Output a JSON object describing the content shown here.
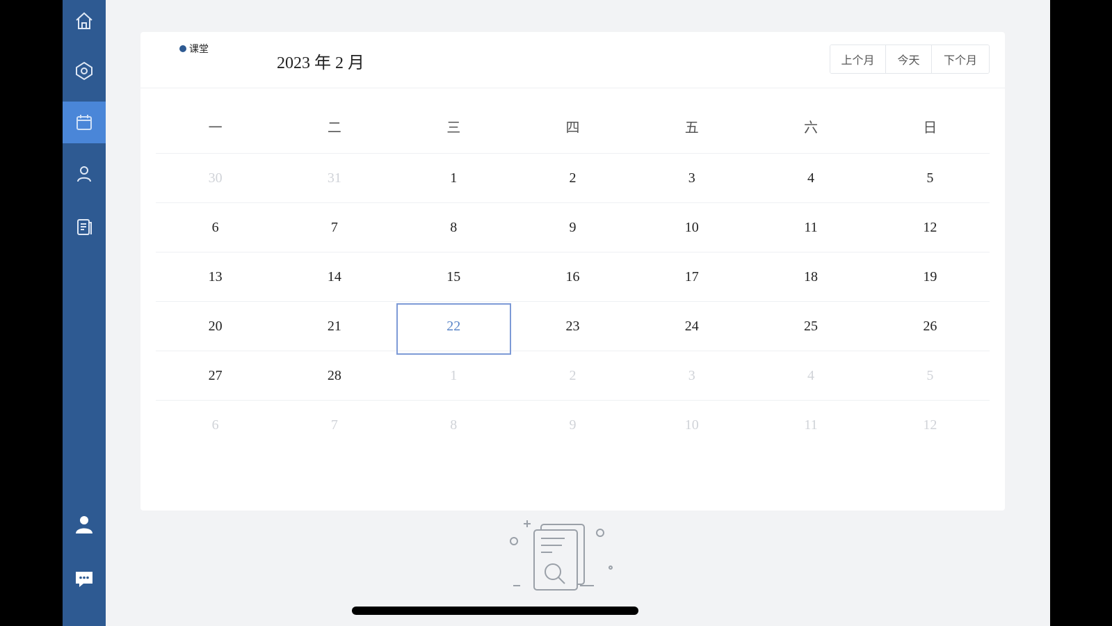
{
  "legend": {
    "label": "课堂",
    "color": "#2e5a92"
  },
  "calendar": {
    "title": "2023 年 2 月",
    "buttons": {
      "prev": "上个月",
      "today": "今天",
      "next": "下个月"
    },
    "weekdays": [
      "一",
      "二",
      "三",
      "四",
      "五",
      "六",
      "日"
    ],
    "weeks": [
      [
        {
          "d": "30",
          "dim": true
        },
        {
          "d": "31",
          "dim": true
        },
        {
          "d": "1"
        },
        {
          "d": "2"
        },
        {
          "d": "3"
        },
        {
          "d": "4"
        },
        {
          "d": "5"
        }
      ],
      [
        {
          "d": "6"
        },
        {
          "d": "7"
        },
        {
          "d": "8"
        },
        {
          "d": "9"
        },
        {
          "d": "10"
        },
        {
          "d": "11"
        },
        {
          "d": "12"
        }
      ],
      [
        {
          "d": "13"
        },
        {
          "d": "14"
        },
        {
          "d": "15"
        },
        {
          "d": "16"
        },
        {
          "d": "17"
        },
        {
          "d": "18"
        },
        {
          "d": "19"
        }
      ],
      [
        {
          "d": "20"
        },
        {
          "d": "21"
        },
        {
          "d": "22",
          "today": true
        },
        {
          "d": "23"
        },
        {
          "d": "24"
        },
        {
          "d": "25"
        },
        {
          "d": "26"
        }
      ],
      [
        {
          "d": "27"
        },
        {
          "d": "28"
        },
        {
          "d": "1",
          "dim": true
        },
        {
          "d": "2",
          "dim": true
        },
        {
          "d": "3",
          "dim": true
        },
        {
          "d": "4",
          "dim": true
        },
        {
          "d": "5",
          "dim": true
        }
      ],
      [
        {
          "d": "6",
          "dim": true
        },
        {
          "d": "7",
          "dim": true
        },
        {
          "d": "8",
          "dim": true
        },
        {
          "d": "9",
          "dim": true
        },
        {
          "d": "10",
          "dim": true
        },
        {
          "d": "11",
          "dim": true
        },
        {
          "d": "12",
          "dim": true
        }
      ]
    ]
  },
  "sidebar": {
    "items": [
      {
        "icon": "home-icon"
      },
      {
        "icon": "dashboard-icon"
      },
      {
        "icon": "calendar-icon",
        "active": true
      },
      {
        "icon": "user-icon"
      },
      {
        "icon": "document-icon"
      },
      {
        "icon": "profile-icon"
      },
      {
        "icon": "chat-icon"
      }
    ]
  },
  "colors": {
    "sidebar": "#2e5a92",
    "active": "#4a86d8",
    "today_border": "#7d9ad6",
    "background": "#f2f3f5"
  }
}
